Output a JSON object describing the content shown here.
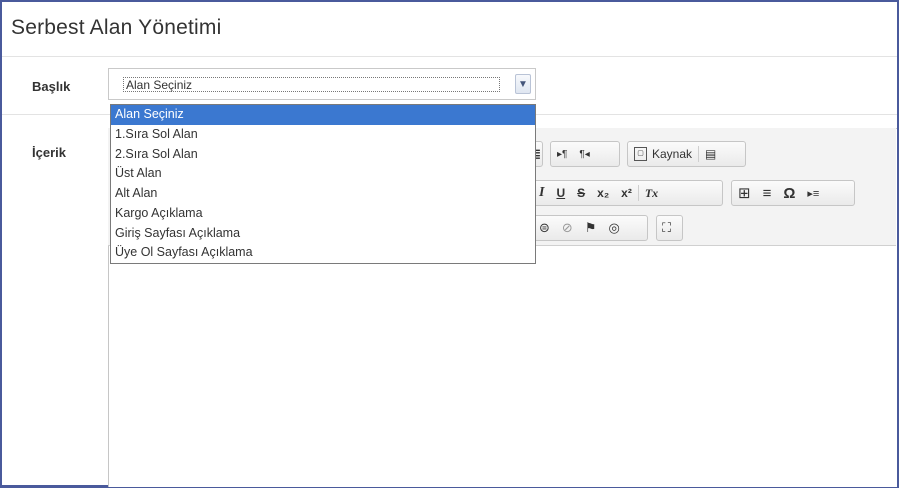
{
  "page": {
    "title": "Serbest Alan Yönetimi"
  },
  "form": {
    "title_label": "Başlık",
    "content_label": "İçerik",
    "select": {
      "value": "Alan Seçiniz"
    }
  },
  "dropdown": {
    "options": [
      "Alan Seçiniz",
      "1.Sıra Sol Alan",
      "2.Sıra Sol Alan",
      "Üst Alan",
      "Alt Alan",
      "Kargo Açıklama",
      "Giriş Sayfası Açıklama",
      "Üye Ol Sayfası Açıklama"
    ]
  },
  "editor": {
    "row1": {
      "justify": "≣",
      "ltr": "▸¶",
      "rtl": "¶◂",
      "source_icon": "▢",
      "source_label": "Kaynak",
      "template": "▤"
    },
    "row2": {
      "italic": "I",
      "underline": "U",
      "strike": "S",
      "subscript": "x₂",
      "superscript": "x²",
      "remove_format": "Tx",
      "table": "⊞",
      "hrule": "≡",
      "special_char": "Ω",
      "indent": "▸≡"
    },
    "row3": {
      "link": "⊜",
      "unlink": "⊘",
      "anchor": "⚑",
      "iframe": "◎",
      "maximize": "⛶"
    }
  }
}
